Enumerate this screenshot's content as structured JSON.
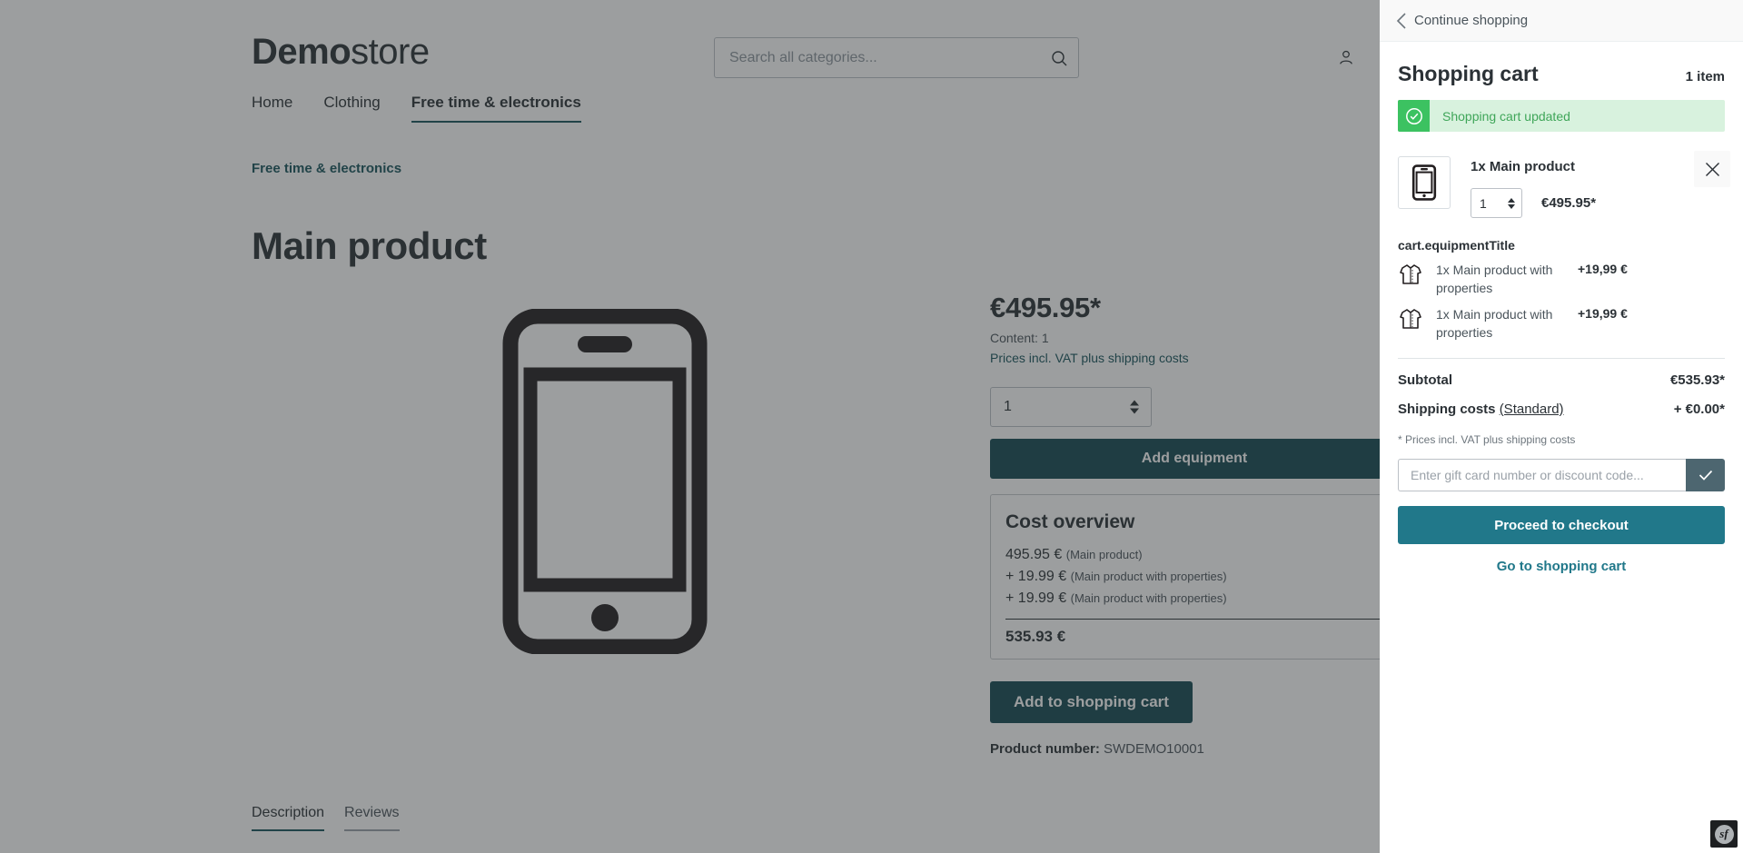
{
  "header": {
    "logo_bold": "Demo",
    "logo_light": "store",
    "search_placeholder": "Search all categories...",
    "search_value": "",
    "search_icon": "search-icon",
    "account_icon": "user-account-icon"
  },
  "nav": {
    "items": [
      {
        "label": "Home",
        "active": false
      },
      {
        "label": "Clothing",
        "active": false
      },
      {
        "label": "Free time & electronics",
        "active": true
      }
    ]
  },
  "product": {
    "breadcrumb": "Free time & electronics",
    "title": "Main product",
    "image_icon": "smartphone-icon",
    "price": "€495.95*",
    "content_line": "Content: 1",
    "tax_link": "Prices incl. VAT plus shipping costs",
    "quantity": "1",
    "add_equipment_label": "Add equipment",
    "add_to_cart_label": "Add to shopping cart",
    "product_number_label": "Product number:",
    "product_number_value": "SWDEMO10001"
  },
  "cost_overview": {
    "title": "Cost overview",
    "rows": [
      {
        "amount": "495.95 €",
        "note": "(Main product)"
      },
      {
        "amount": "+ 19.99 €",
        "note": "(Main product with properties)"
      },
      {
        "amount": "+ 19.99 €",
        "note": "(Main product with properties)"
      }
    ],
    "total": "535.93 €"
  },
  "detail_tabs": [
    {
      "label": "Description",
      "active": true
    },
    {
      "label": "Reviews",
      "active": false
    }
  ],
  "cart": {
    "back_label": "Continue shopping",
    "back_icon": "chevron-left-icon",
    "title": "Shopping cart",
    "item_count": "1 item",
    "alert": {
      "text": "Shopping cart updated",
      "icon": "check-circle-icon",
      "bg": "#d8f2de",
      "icon_bg": "#3cc261",
      "text_color": "#3fa659"
    },
    "line_item": {
      "thumb_icon": "smartphone-icon",
      "name": "1x Main product",
      "quantity": "1",
      "price": "€495.95*",
      "remove_icon": "close-icon"
    },
    "equipment_title": "cart.equipmentTitle",
    "equipment": [
      {
        "icon": "shirt-icon",
        "name": "1x Main product with properties",
        "price": "+19,99 €"
      },
      {
        "icon": "shirt-icon",
        "name": "1x Main product with properties",
        "price": "+19,99 €"
      }
    ],
    "totals": [
      {
        "label": "Subtotal",
        "option": "",
        "value": "€535.93*"
      },
      {
        "label": "Shipping costs",
        "option": "(Standard)",
        "value": "+ €0.00*"
      }
    ],
    "vat_note": "* Prices incl. VAT plus shipping costs",
    "promo_placeholder": "Enter gift card number or discount code...",
    "promo_value": "",
    "promo_submit_icon": "check-icon",
    "checkout_label": "Proceed to checkout",
    "go_to_cart_label": "Go to shopping cart"
  },
  "debug_badge": {
    "label": "sf",
    "name": "symfony-toolbar-badge"
  },
  "colors": {
    "accent_dark": "#134852",
    "accent_teal": "#21788a",
    "link_teal": "#17535c",
    "text_dark": "#2b3136",
    "text_muted": "#4a545b",
    "success": "#3cc261"
  }
}
